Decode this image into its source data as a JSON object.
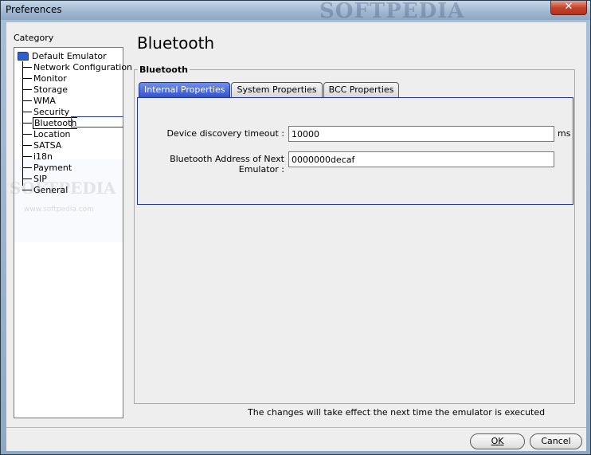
{
  "window": {
    "title": "Preferences",
    "watermark": "SOFTPEDIA",
    "close_label": "✕"
  },
  "category": {
    "label": "Category",
    "root": "Default Emulator",
    "items": [
      {
        "label": "Network Configuration"
      },
      {
        "label": "Monitor"
      },
      {
        "label": "Storage"
      },
      {
        "label": "WMA"
      },
      {
        "label": "Security"
      },
      {
        "label": "Bluetooth",
        "selected": true
      },
      {
        "label": "Location"
      },
      {
        "label": "SATSA"
      },
      {
        "label": "i18n"
      },
      {
        "label": "Payment"
      },
      {
        "label": "SIP"
      },
      {
        "label": "General"
      }
    ],
    "watermark": "SOFTPEDIA",
    "watermark_url": "www.softpedia.com"
  },
  "main": {
    "title": "Bluetooth",
    "group_title": "Bluetooth",
    "tabs": [
      {
        "label": "Internal Properties",
        "active": true
      },
      {
        "label": "System Properties"
      },
      {
        "label": "BCC Properties"
      }
    ],
    "fields": {
      "discovery_label": "Device discovery timeout :",
      "discovery_value": "10000",
      "discovery_unit": "ms",
      "address_label": "Bluetooth Address of Next Emulator :",
      "address_value": "0000000decaf"
    },
    "notice": "The changes will take effect the next time the emulator is executed"
  },
  "footer": {
    "ok_label": "OK",
    "cancel_label": "Cancel"
  },
  "colors": {
    "accent": "#3352c8",
    "folder": "#2f5fc8",
    "close": "#c7432a"
  },
  "icons": {
    "root": "folder-icon",
    "close": "close-icon"
  }
}
